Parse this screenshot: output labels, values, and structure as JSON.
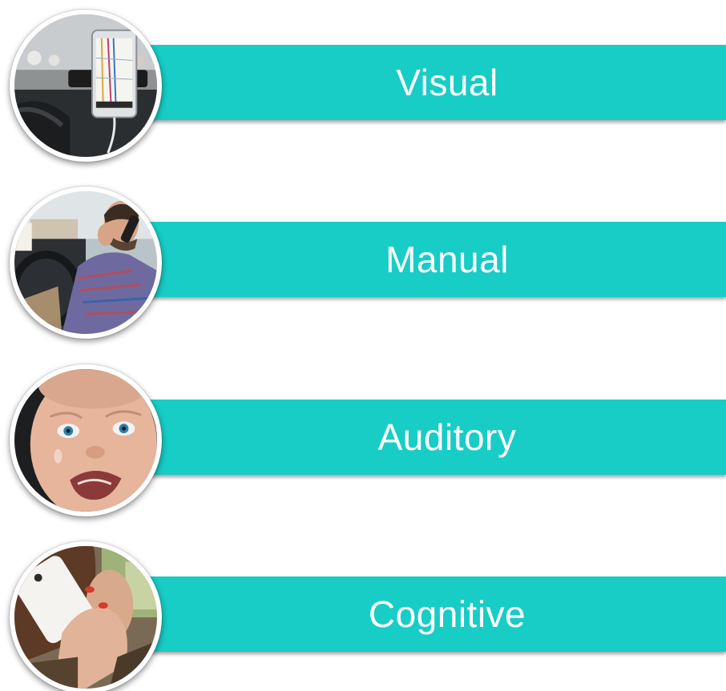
{
  "categories": [
    {
      "label": "Visual",
      "image": "phone-navigation-in-car"
    },
    {
      "label": "Manual",
      "image": "man-on-phone-driving"
    },
    {
      "label": "Auditory",
      "image": "crying-baby"
    },
    {
      "label": "Cognitive",
      "image": "woman-on-phone"
    }
  ],
  "colors": {
    "banner": "#17cdc6",
    "text": "#ffffff"
  }
}
